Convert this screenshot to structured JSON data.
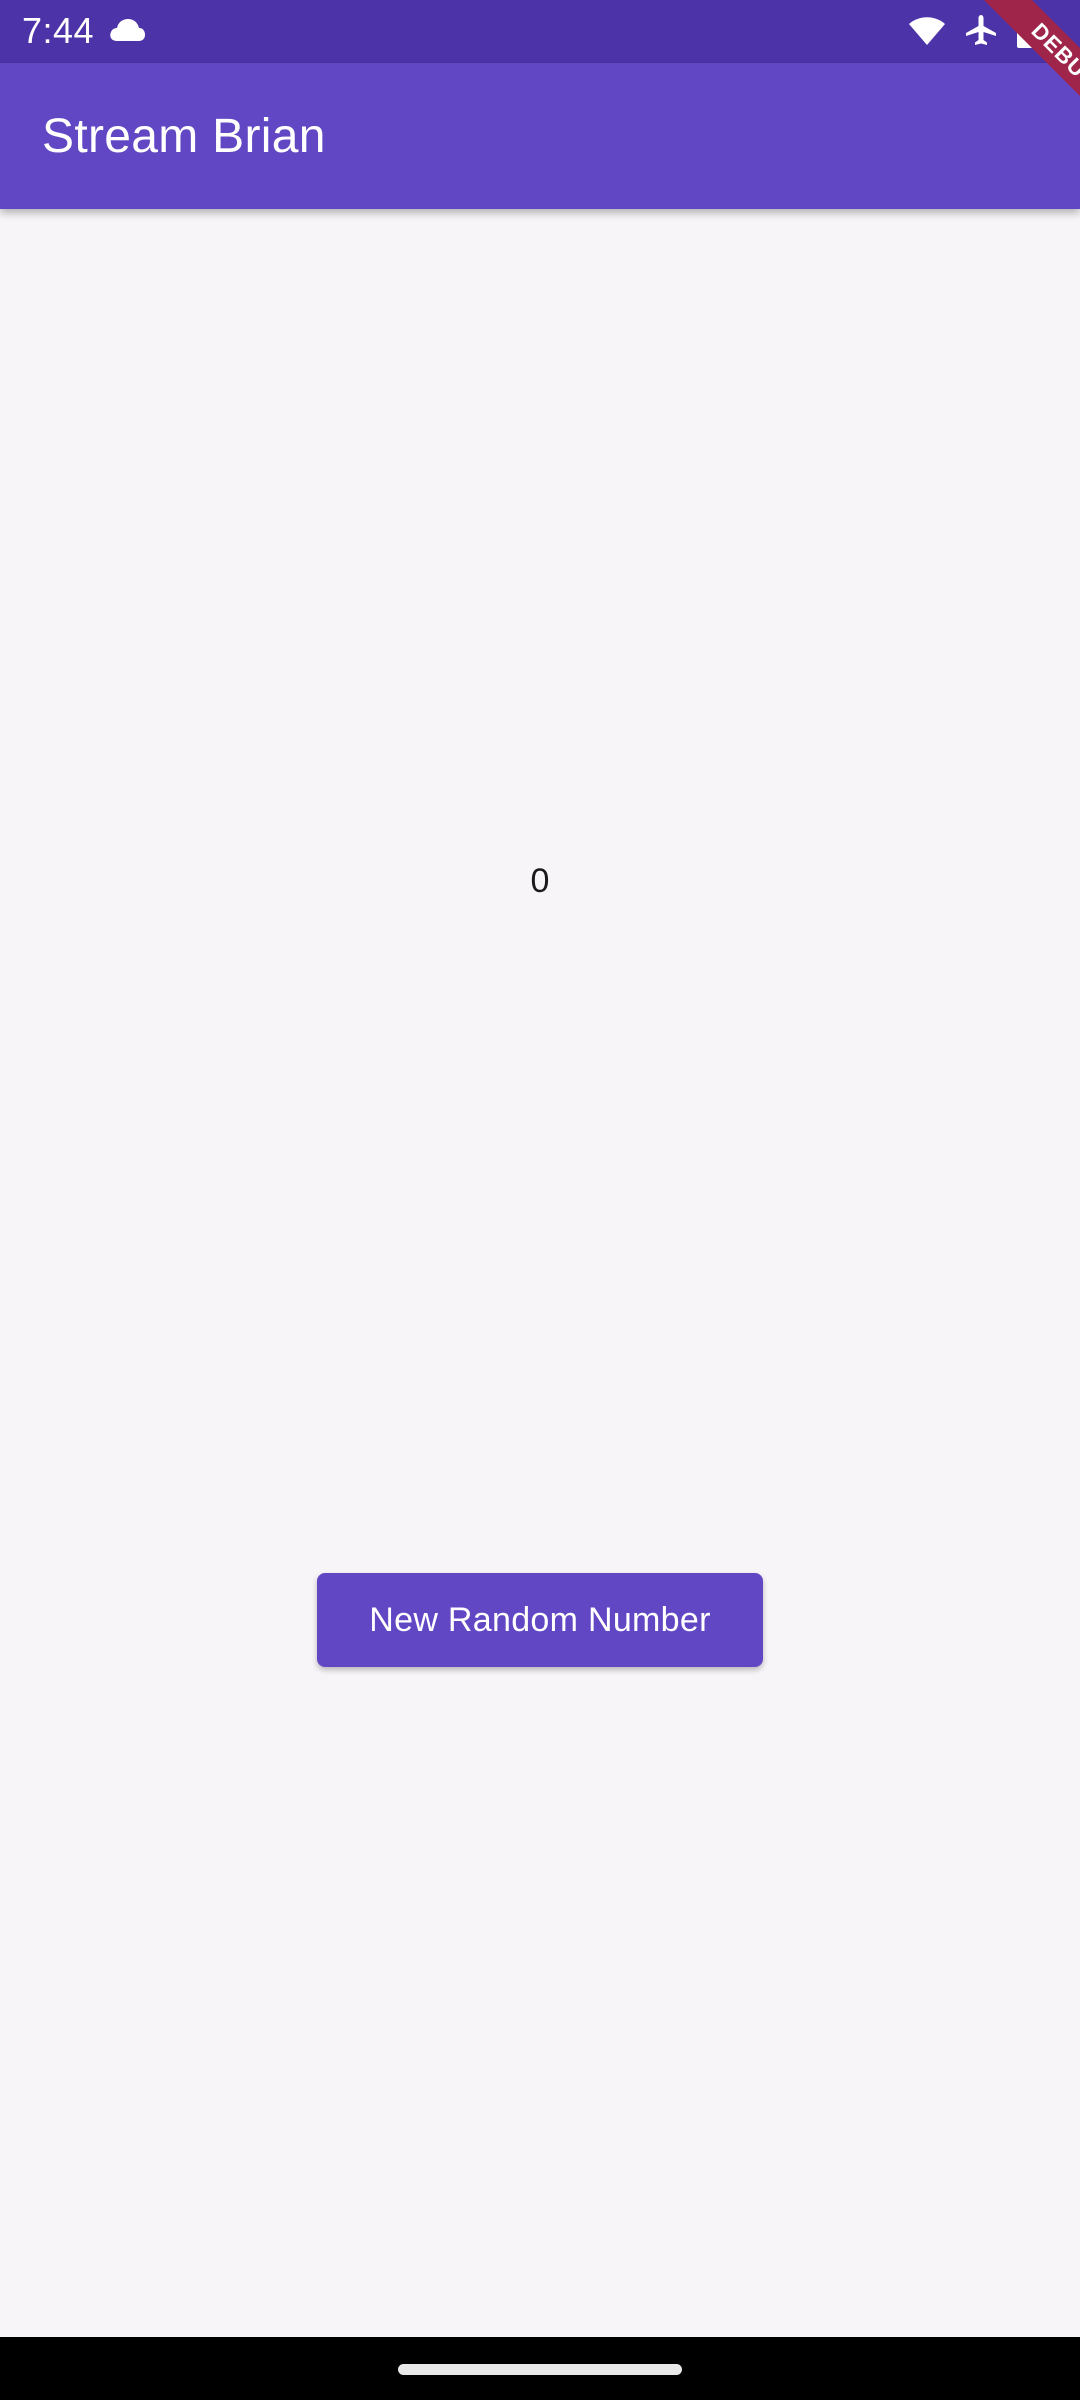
{
  "status_bar": {
    "time": "7:44",
    "icons": [
      "cloud-icon",
      "wifi-icon",
      "airplane-mode-icon",
      "battery-icon"
    ],
    "color": "#4d33a8"
  },
  "app_bar": {
    "title": "Stream Brian",
    "color": "#6247c4"
  },
  "debug_banner": {
    "label": "DEBUG",
    "color": "#a0254a"
  },
  "main": {
    "counter_value": "0",
    "button_label": "New Random Number",
    "button_color": "#6247c4",
    "background": "#f7f5f8"
  }
}
